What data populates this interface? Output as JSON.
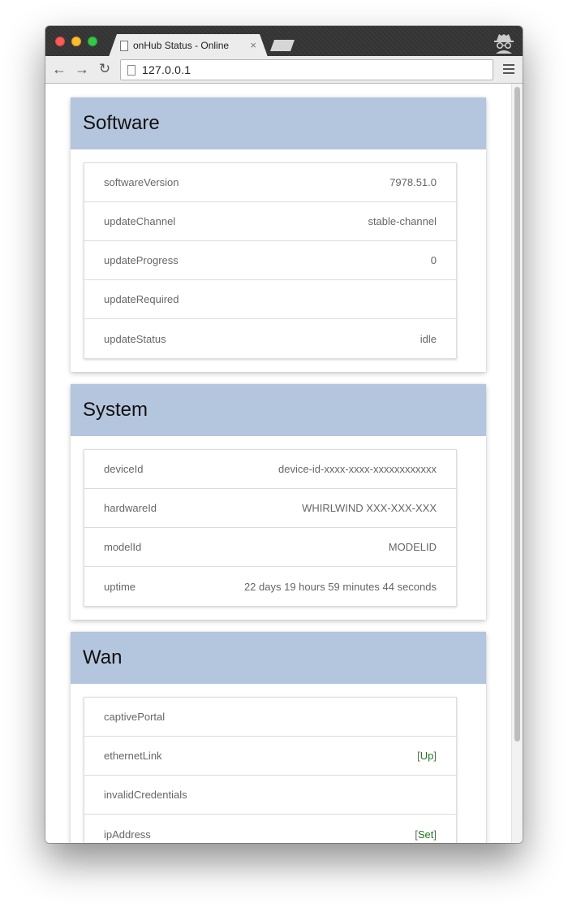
{
  "browser": {
    "tab_title": "onHub Status - Online",
    "tab_close": "×",
    "url": "127.0.0.1",
    "nav": {
      "back": "←",
      "forward": "→",
      "reload": "↻"
    }
  },
  "colors": {
    "header_bg": "#b4c5de",
    "status_green": "#1b7a1b"
  },
  "sections": [
    {
      "title": "Software",
      "rows": [
        {
          "key": "softwareVersion",
          "value": "7978.51.0"
        },
        {
          "key": "updateChannel",
          "value": "stable-channel"
        },
        {
          "key": "updateProgress",
          "value": "0"
        },
        {
          "key": "updateRequired",
          "value": ""
        },
        {
          "key": "updateStatus",
          "value": "idle"
        }
      ]
    },
    {
      "title": "System",
      "rows": [
        {
          "key": "deviceId",
          "value": "device-id-xxxx-xxxx-xxxxxxxxxxxx"
        },
        {
          "key": "hardwareId",
          "value": "WHIRLWIND XXX-XXX-XXX"
        },
        {
          "key": "modelId",
          "value": "MODELID"
        },
        {
          "key": "uptime",
          "value": "22 days 19 hours 59 minutes 44 seconds"
        }
      ]
    },
    {
      "title": "Wan",
      "rows": [
        {
          "key": "captivePortal",
          "value": ""
        },
        {
          "key": "ethernetLink",
          "open": "[",
          "value": "Up",
          "close": "]"
        },
        {
          "key": "invalidCredentials",
          "value": ""
        },
        {
          "key": "ipAddress",
          "open": "[",
          "value": "Set",
          "close": "]"
        }
      ]
    }
  ]
}
